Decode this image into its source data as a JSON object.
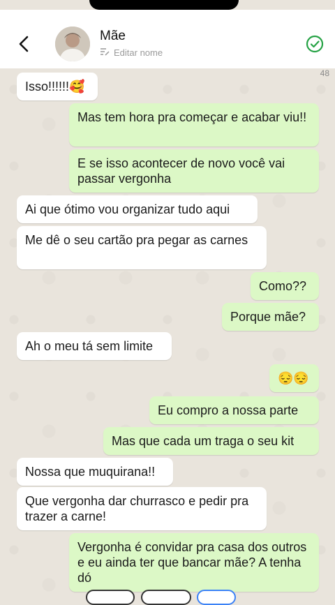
{
  "header": {
    "contact_name": "Mãe",
    "edit_label": "Editar nome"
  },
  "message_count": "48",
  "messages": [
    {
      "dir": "in",
      "text": "Isso!!!!!!🥰"
    },
    {
      "dir": "out",
      "text": "Mas tem hora pra começar e acabar viu!!"
    },
    {
      "dir": "out",
      "text": "E se isso acontecer de novo você vai passar vergonha"
    },
    {
      "dir": "in",
      "text": "Ai que ótimo vou organizar tudo aqui"
    },
    {
      "dir": "in",
      "text": "Me dê o seu cartão pra pegar as carnes"
    },
    {
      "dir": "out",
      "text": "Como??"
    },
    {
      "dir": "out",
      "text": "Porque mãe?"
    },
    {
      "dir": "in",
      "text": "Ah o meu tá sem limite"
    },
    {
      "dir": "out",
      "text": "😔😔"
    },
    {
      "dir": "out",
      "text": "Eu compro a nossa parte"
    },
    {
      "dir": "out",
      "text": "Mas que cada um traga o seu kit"
    },
    {
      "dir": "in",
      "text": "Nossa que muquirana!!"
    },
    {
      "dir": "in",
      "text": "Que vergonha dar churrasco e pedir pra trazer a carne!"
    },
    {
      "dir": "out",
      "text": "Vergonha é convidar pra casa dos outros e eu ainda ter que bancar mãe? A tenha dó"
    }
  ],
  "colors": {
    "incoming": "#ffffff",
    "outgoing": "#dcf8c6",
    "check": "#25a244"
  },
  "icons": [
    "back-arrow-icon",
    "edit-icon",
    "check-circle-icon"
  ]
}
